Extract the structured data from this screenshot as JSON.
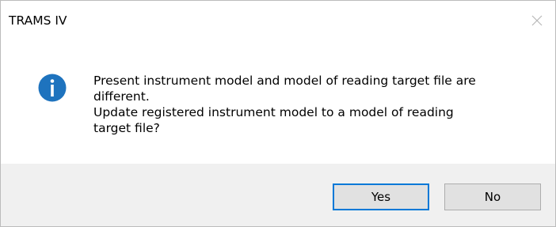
{
  "window": {
    "title": "TRAMS IV"
  },
  "titlebar": {
    "close_icon": "close-icon"
  },
  "message": {
    "icon": "info-icon",
    "lines": [
      "Present instrument model and model of reading target file are",
      "different.",
      "Update registered instrument model to a model of reading",
      "target file?"
    ]
  },
  "buttons": {
    "yes_label": "Yes",
    "no_label": "No",
    "default": "Yes"
  },
  "colors": {
    "info_icon_fill": "#1e73be",
    "default_button_border": "#0078d7",
    "footer_background": "#f0f0f0"
  }
}
